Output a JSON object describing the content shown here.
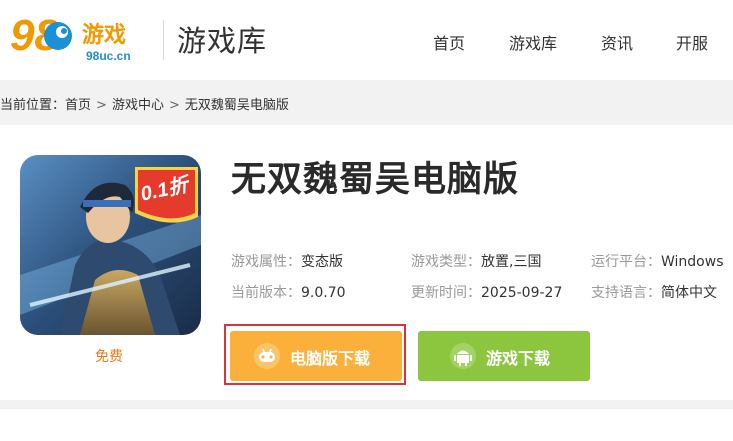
{
  "logo": {
    "number": "98",
    "brand": "游戏",
    "domain": "98uc.cn"
  },
  "header": {
    "title": "游戏库"
  },
  "nav": [
    "首页",
    "游戏库",
    "资讯",
    "开服"
  ],
  "breadcrumb": {
    "prefix": "当前位置：",
    "items": [
      "首页",
      "游戏中心",
      "无双魏蜀吴电脑版"
    ],
    "separator": ">"
  },
  "game": {
    "title": "无双魏蜀吴电脑版",
    "discount_badge": "0.1折",
    "price_label": "免费",
    "attributes": [
      {
        "label": "游戏属性：",
        "value": "变态版"
      },
      {
        "label": "游戏类型：",
        "value": "放置,三国"
      },
      {
        "label": "运行平台：",
        "value": "Windows"
      },
      {
        "label": "当前版本：",
        "value": "9.0.70"
      },
      {
        "label": "更新时间：",
        "value": "2025-09-27"
      },
      {
        "label": "支持语言：",
        "value": "简体中文"
      }
    ]
  },
  "buttons": {
    "pc_download": "电脑版下载",
    "game_download": "游戏下载"
  },
  "colors": {
    "logo_orange": "#f39800",
    "logo_blue": "#1c8fd6",
    "price": "#e27b1e",
    "pc_button": "#fbb03b",
    "game_button": "#8cc63f",
    "highlight_border": "#d9343c"
  },
  "icons": {
    "logo": "98uc-logo",
    "pc_button": "gamepad-icon",
    "game_button": "android-icon"
  }
}
